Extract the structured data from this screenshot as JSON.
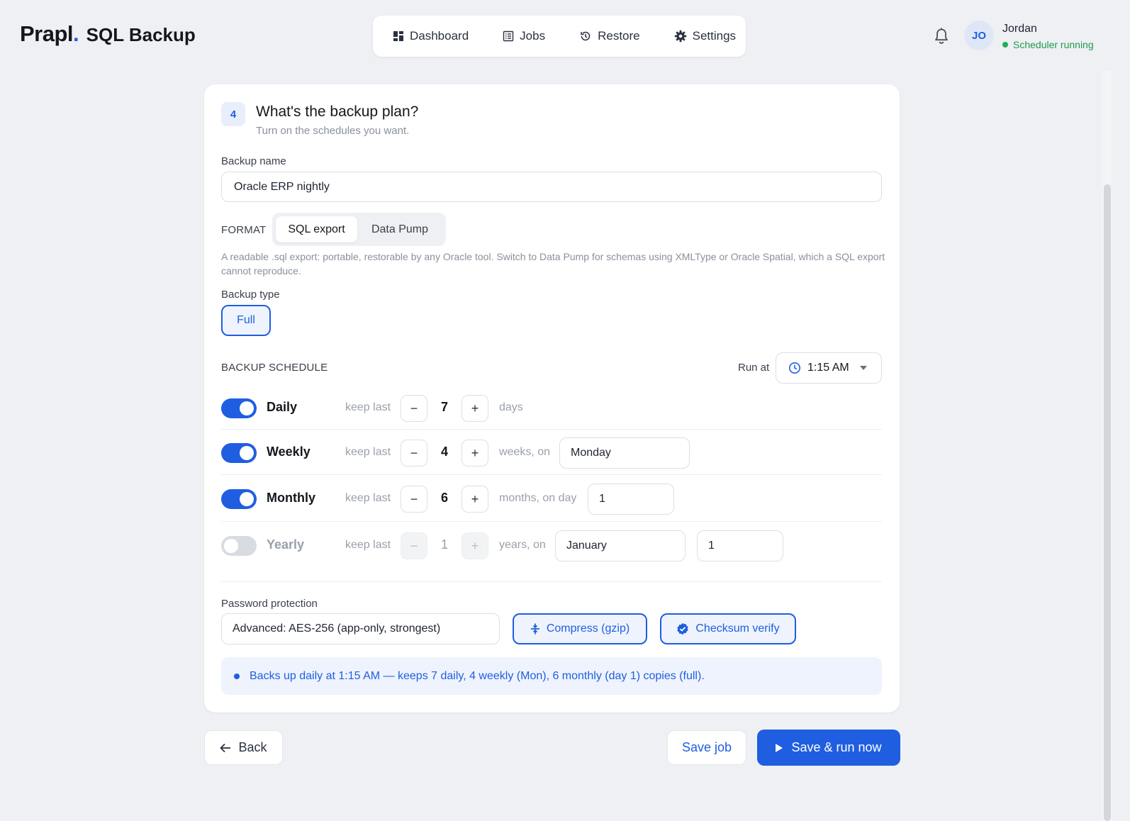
{
  "brand": {
    "logo": "Prapl",
    "dot": ".",
    "product": "SQL Backup"
  },
  "nav": [
    {
      "label": "Dashboard",
      "icon": "dashboard-icon"
    },
    {
      "label": "Jobs",
      "icon": "jobs-icon"
    },
    {
      "label": "Restore",
      "icon": "restore-icon"
    },
    {
      "label": "Settings",
      "icon": "gear-icon"
    }
  ],
  "user": {
    "initials": "JO",
    "name": "Jordan",
    "status": "Scheduler running"
  },
  "colors": {
    "accent": "#1f5ee0",
    "status_ok": "#1fae55",
    "background": "#eef0f4"
  },
  "step": {
    "number": "4",
    "title": "What's the backup plan?",
    "subtitle": "Turn on the schedules you want."
  },
  "backup_name": {
    "label": "Backup name",
    "value": "Oracle ERP nightly"
  },
  "format": {
    "label": "FORMAT",
    "options": [
      "SQL export",
      "Data Pump"
    ],
    "selected": "SQL export",
    "help": "A readable .sql export: portable, restorable by any Oracle tool. Switch to Data Pump for schemas using XMLType or Oracle Spatial, which a SQL export cannot reproduce."
  },
  "backup_type": {
    "label": "Backup type",
    "selected": "Full"
  },
  "schedule": {
    "label": "BACKUP SCHEDULE",
    "run_at_label": "Run at",
    "run_at": "1:15 AM",
    "keep_label": "keep last",
    "rows": [
      {
        "name": "Daily",
        "enabled": true,
        "keep": "7",
        "unit": "days"
      },
      {
        "name": "Weekly",
        "enabled": true,
        "keep": "4",
        "unit": "weeks, on",
        "field1": "Monday"
      },
      {
        "name": "Monthly",
        "enabled": true,
        "keep": "6",
        "unit": "months, on day",
        "field1": "1"
      },
      {
        "name": "Yearly",
        "enabled": false,
        "keep": "1",
        "unit": "years, on",
        "field1": "January",
        "field2": "1"
      }
    ]
  },
  "password": {
    "label": "Password protection",
    "value": "Advanced: AES-256 (app-only, strongest)"
  },
  "options": {
    "compress": "Compress (gzip)",
    "checksum": "Checksum verify"
  },
  "summary": "Backs up daily at 1:15 AM — keeps 7 daily, 4 weekly (Mon), 6 monthly (day 1) copies (full).",
  "footer": {
    "back": "Back",
    "save": "Save job",
    "run": "Save & run now"
  }
}
